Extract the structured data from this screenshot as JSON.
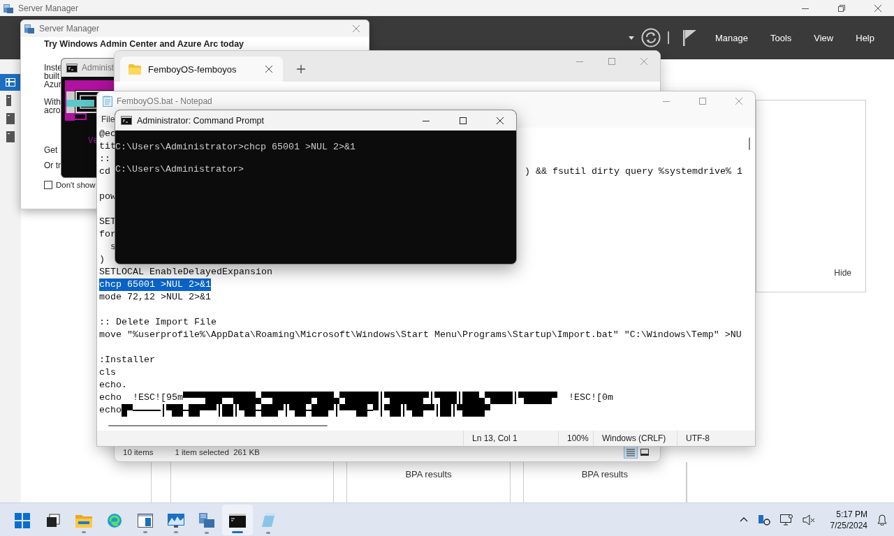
{
  "server_manager": {
    "title": "Server Manager",
    "menu": [
      "Manage",
      "Tools",
      "View",
      "Help"
    ],
    "nav": [
      {
        "selected": true
      },
      {
        "selected": false
      },
      {
        "selected": false
      },
      {
        "selected": false
      }
    ],
    "side_panel": {
      "link": "Hide"
    },
    "tiles": [
      {
        "label": "BPA results"
      },
      {
        "label": "BPA results"
      }
    ]
  },
  "dialog": {
    "title": "Server Manager",
    "heading": "Try Windows Admin Center and Azure Arc today",
    "paragraphs": [
      [
        "Inste",
        "built",
        "Azur"
      ],
      [
        "With",
        "acro"
      ],
      [
        "Get"
      ],
      [
        "Or tr"
      ]
    ],
    "checkbox": {
      "label": "Don't show",
      "checked": false
    }
  },
  "background_console": {
    "title": "Administ",
    "text": "Ve"
  },
  "explorer": {
    "tabs": [
      {
        "label": "FemboyOS-femboyos",
        "selected": true
      }
    ],
    "status": [
      "10 items",
      "1 item selected  261 KB"
    ],
    "views": [
      {
        "selected": true
      },
      {
        "selected": false
      }
    ]
  },
  "notepad": {
    "title": "FemboyOS.bat - Notepad",
    "menu": [
      "File"
    ],
    "lines": [
      {
        "kind": "code",
        "text": "@ec",
        "selected": false
      },
      {
        "kind": "code",
        "text": "tit",
        "selected": false
      },
      {
        "kind": "code",
        "text": "::",
        "selected": false
      },
      {
        "kind": "code",
        "text": "cd",
        "tail": ") && fsutil dirty query %systemdrive% 1",
        "selected": false
      },
      {
        "kind": "blank"
      },
      {
        "kind": "code",
        "text": "pow",
        "selected": false
      },
      {
        "kind": "blank"
      },
      {
        "kind": "code",
        "text": "SET",
        "selected": false
      },
      {
        "kind": "code",
        "text": "for",
        "selected": false
      },
      {
        "kind": "code",
        "text": "  s",
        "selected": false
      },
      {
        "kind": "code",
        "text": ")",
        "selected": false
      },
      {
        "kind": "code",
        "text": "SETLOCAL EnableDelayedExpansion",
        "selected": false
      },
      {
        "kind": "code",
        "text": "chcp 65001 >NUL 2>&1",
        "selected": true
      },
      {
        "kind": "code",
        "text": "mode 72,12 >NUL 2>&1",
        "selected": false
      },
      {
        "kind": "blank"
      },
      {
        "kind": "code",
        "text": ":: Delete Import File",
        "selected": false
      },
      {
        "kind": "code",
        "text": "move \"%userprofile%\\AppData\\Roaming\\Microsoft\\Windows\\Start Menu\\Programs\\Startup\\Import.bat\" \"C:\\Windows\\Temp\" >NU",
        "selected": false
      },
      {
        "kind": "blank"
      },
      {
        "kind": "code",
        "text": ":Installer",
        "selected": false
      },
      {
        "kind": "code",
        "text": "cls",
        "selected": false
      },
      {
        "kind": "code",
        "text": "echo.",
        "selected": false
      },
      {
        "kind": "art",
        "text": "echo  !ESC![95m",
        "tail": "!ESC![0m",
        "selected": false
      },
      {
        "kind": "art",
        "text": "echo",
        "selected": false
      }
    ],
    "status": [
      "Ln 13, Col 1",
      "100%",
      "Windows (CRLF)",
      "UTF-8"
    ]
  },
  "console": {
    "title": "Administrator: Command Prompt",
    "lines": [
      "C:\\Users\\Administrator>chcp 65001 >NUL 2>&1",
      "C:\\Users\\Administrator>"
    ]
  },
  "taskbar": {
    "apps": [
      {
        "running": false,
        "selected": false
      },
      {
        "running": false,
        "selected": false
      },
      {
        "running": true,
        "selected": false
      },
      {
        "running": false,
        "selected": false
      },
      {
        "running": true,
        "selected": false
      },
      {
        "running": true,
        "selected": false
      },
      {
        "running": true,
        "selected": false
      },
      {
        "running": true,
        "selected": true
      },
      {
        "running": true,
        "selected": false
      }
    ],
    "time": "5:17 PM",
    "date": "7/25/2024"
  }
}
